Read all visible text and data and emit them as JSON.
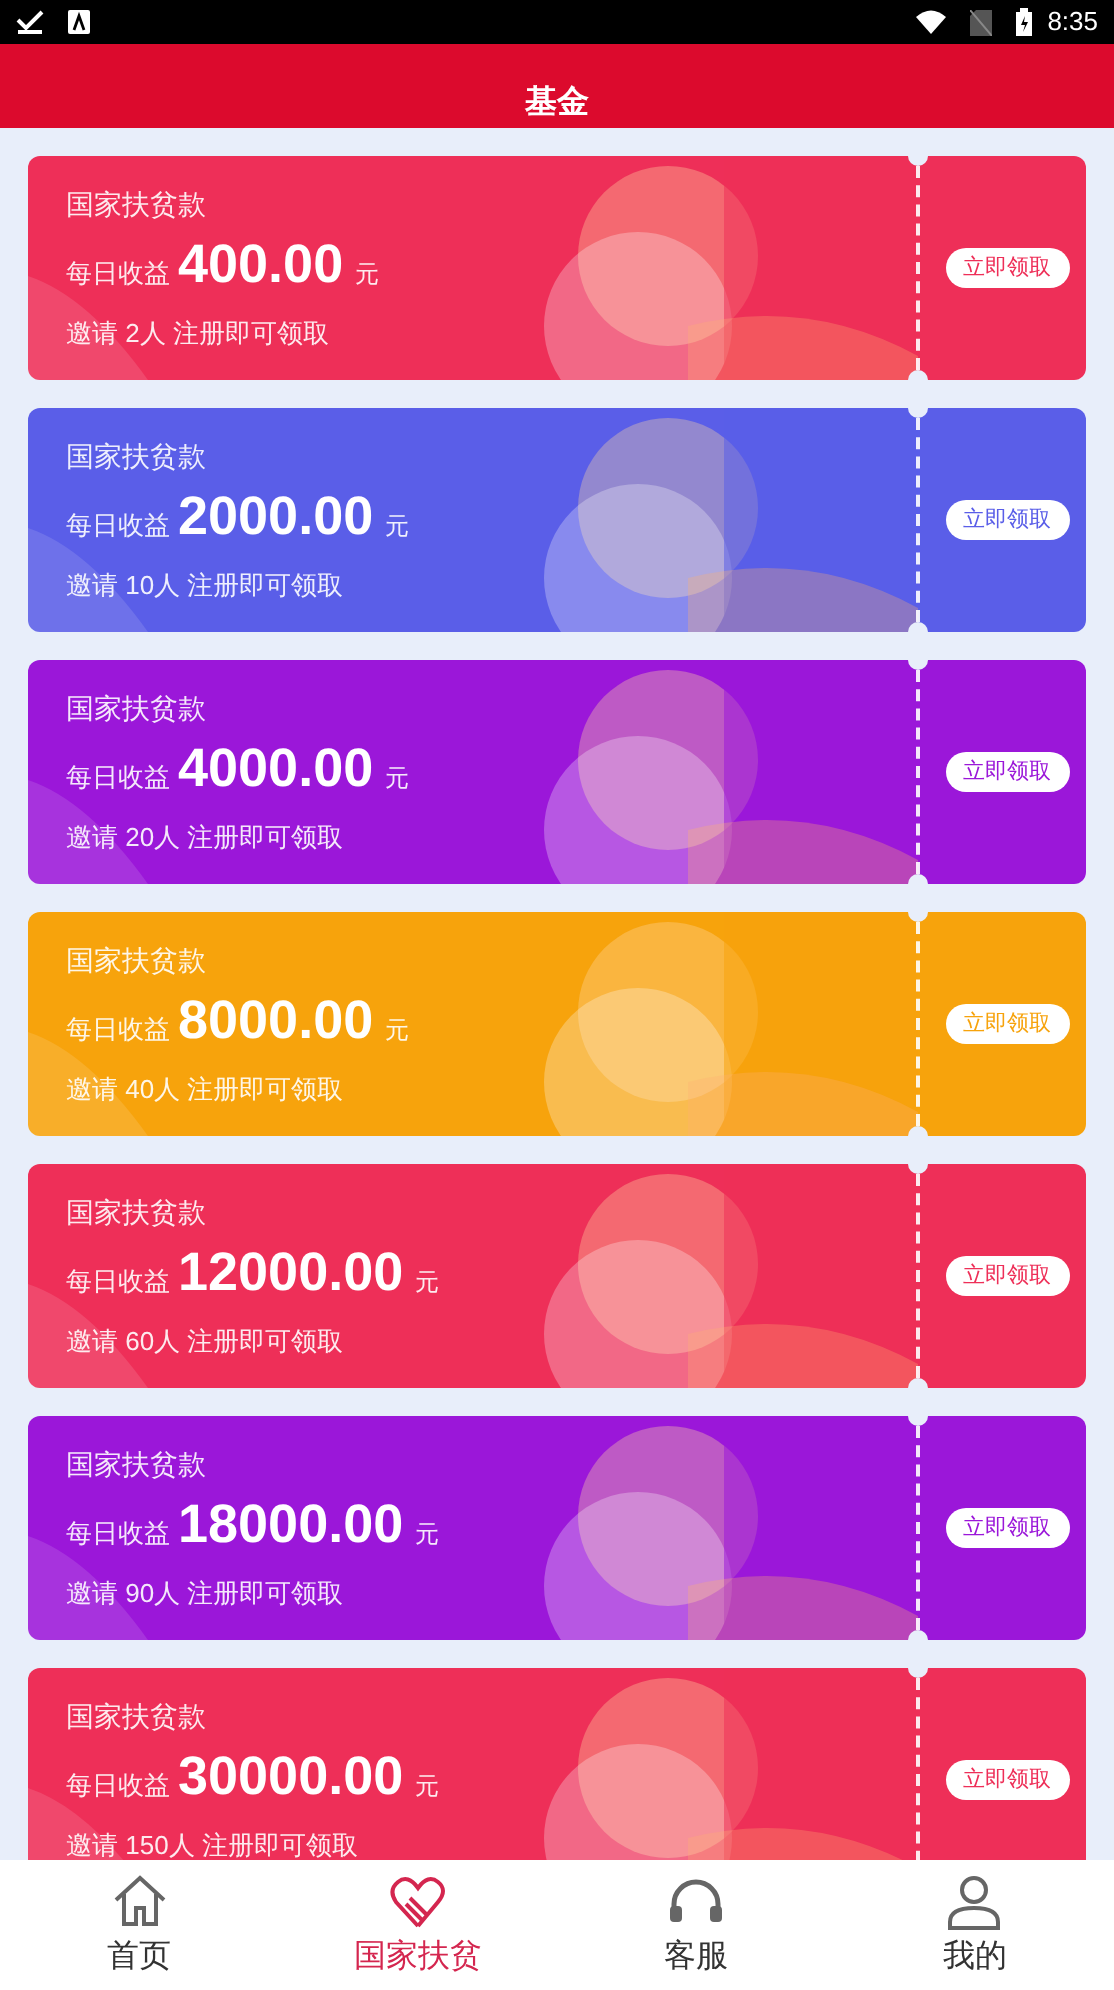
{
  "status_bar": {
    "time": "8:35"
  },
  "header": {
    "title": "基金"
  },
  "cards": [
    {
      "title": "国家扶贫款",
      "label": "每日收益",
      "amount": "400.00",
      "unit": "元",
      "note": "邀请 2人 注册即可领取",
      "button": "立即领取",
      "color": "#ee2f58"
    },
    {
      "title": "国家扶贫款",
      "label": "每日收益",
      "amount": "2000.00",
      "unit": "元",
      "note": "邀请 10人 注册即可领取",
      "button": "立即领取",
      "color": "#5a5ee8"
    },
    {
      "title": "国家扶贫款",
      "label": "每日收益",
      "amount": "4000.00",
      "unit": "元",
      "note": "邀请 20人 注册即可领取",
      "button": "立即领取",
      "color": "#9b17d9"
    },
    {
      "title": "国家扶贫款",
      "label": "每日收益",
      "amount": "8000.00",
      "unit": "元",
      "note": "邀请 40人 注册即可领取",
      "button": "立即领取",
      "color": "#f7a30c"
    },
    {
      "title": "国家扶贫款",
      "label": "每日收益",
      "amount": "12000.00",
      "unit": "元",
      "note": "邀请 60人 注册即可领取",
      "button": "立即领取",
      "color": "#ee2f58"
    },
    {
      "title": "国家扶贫款",
      "label": "每日收益",
      "amount": "18000.00",
      "unit": "元",
      "note": "邀请 90人 注册即可领取",
      "button": "立即领取",
      "color": "#9b17d9"
    },
    {
      "title": "国家扶贫款",
      "label": "每日收益",
      "amount": "30000.00",
      "unit": "元",
      "note": "邀请 150人 注册即可领取",
      "button": "立即领取",
      "color": "#ee2f58"
    }
  ],
  "nav": [
    {
      "kind": "home",
      "label": "首页",
      "selected": false
    },
    {
      "kind": "heart",
      "label": "国家扶贫",
      "selected": true
    },
    {
      "kind": "headset",
      "label": "客服",
      "selected": false
    },
    {
      "kind": "user",
      "label": "我的",
      "selected": false
    }
  ]
}
